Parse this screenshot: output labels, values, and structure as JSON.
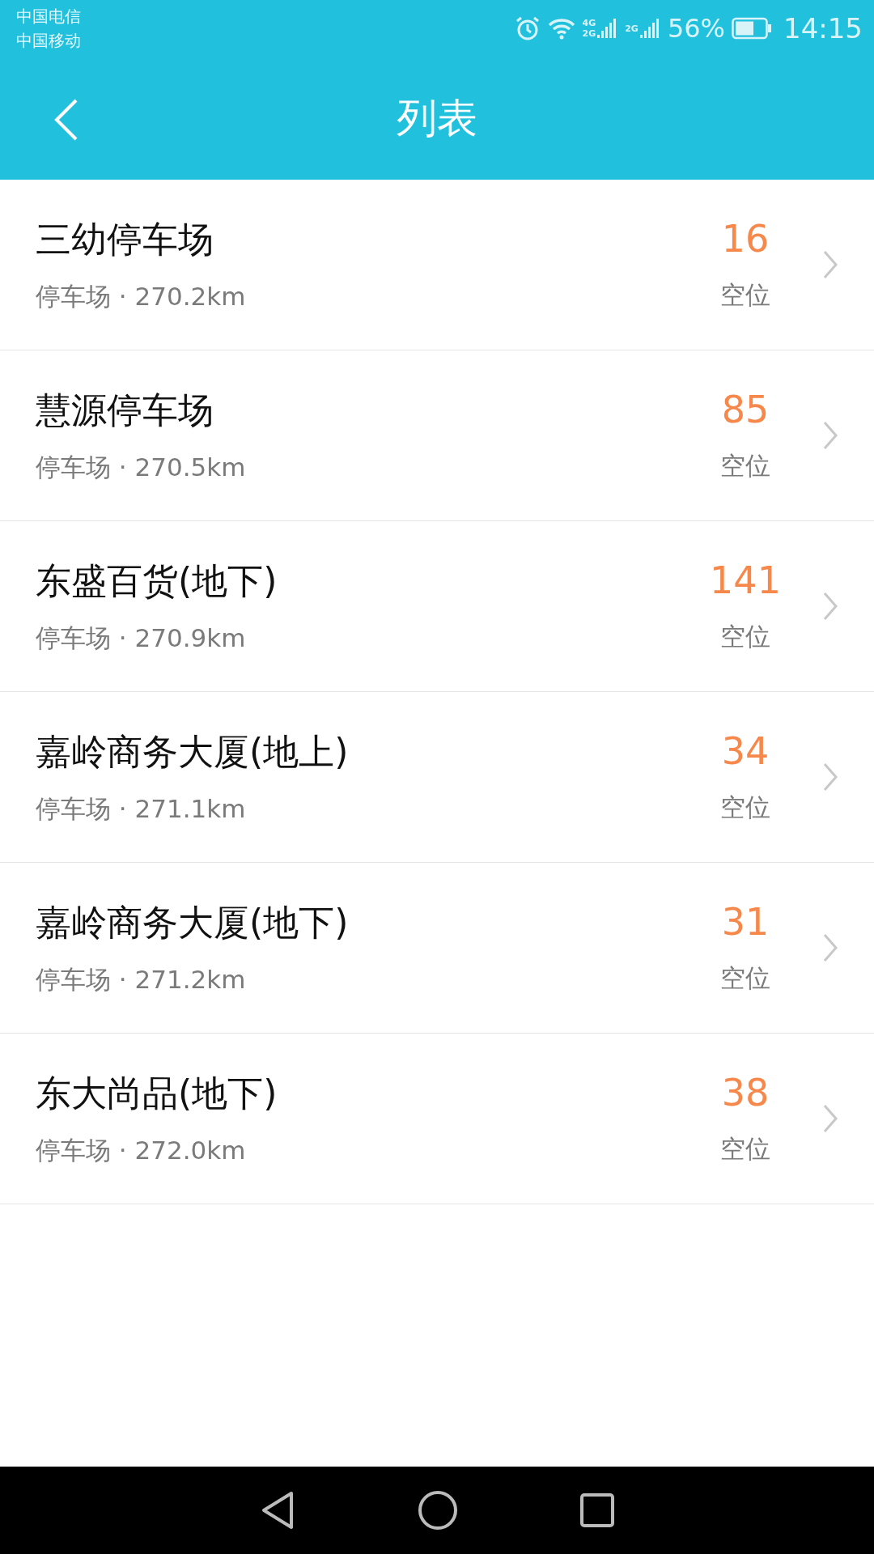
{
  "status_bar": {
    "carriers": [
      "中国电信",
      "中国移动"
    ],
    "sim1_labels": [
      "4G",
      "2G"
    ],
    "sim2_label": "2G",
    "battery": "56%",
    "time": "14:15"
  },
  "header": {
    "title": "列表"
  },
  "lots": [
    {
      "name": "三幼停车场",
      "meta": "停车场 · 270.2km",
      "count": "16",
      "count_label": "空位"
    },
    {
      "name": "慧源停车场",
      "meta": "停车场 · 270.5km",
      "count": "85",
      "count_label": "空位"
    },
    {
      "name": "东盛百货(地下)",
      "meta": "停车场 · 270.9km",
      "count": "141",
      "count_label": "空位"
    },
    {
      "name": "嘉岭商务大厦(地上)",
      "meta": "停车场 · 271.1km",
      "count": "34",
      "count_label": "空位"
    },
    {
      "name": "嘉岭商务大厦(地下)",
      "meta": "停车场 · 271.2km",
      "count": "31",
      "count_label": "空位"
    },
    {
      "name": "东大尚品(地下)",
      "meta": "停车场 · 272.0km",
      "count": "38",
      "count_label": "空位"
    }
  ]
}
